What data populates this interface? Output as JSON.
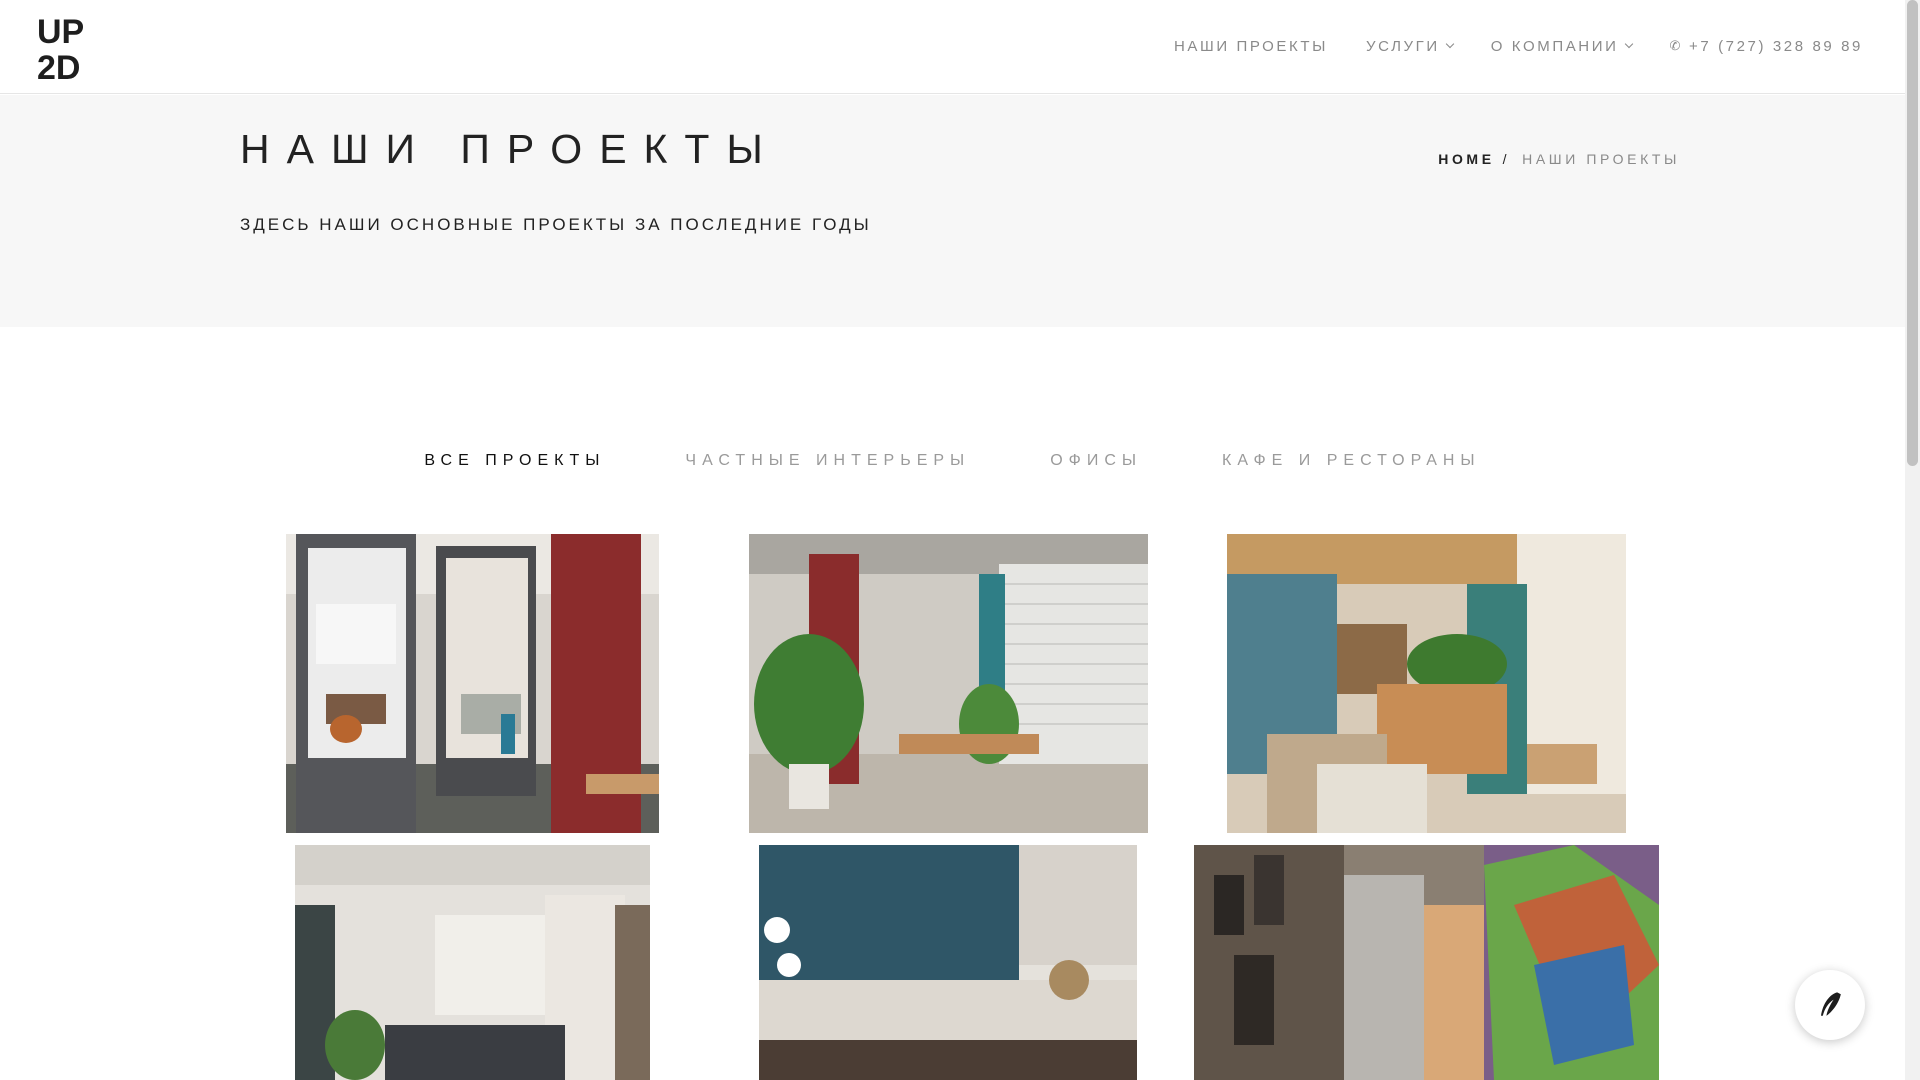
{
  "header": {
    "logo_top": "UP",
    "logo_bottom": "2D",
    "nav": [
      {
        "label": "НАШИ ПРОЕКТЫ"
      },
      {
        "label": "УСЛУГИ"
      },
      {
        "label": "О КОМПАНИИ"
      }
    ],
    "phone": "+7 (727) 328 89 89"
  },
  "title_band": {
    "title": "НАШИ ПРОЕКТЫ",
    "subtitle": "ЗДЕСЬ НАШИ ОСНОВНЫЕ ПРОЕКТЫ ЗА ПОСЛЕДНИЕ ГОДЫ",
    "breadcrumb_home": "HOME",
    "breadcrumb_sep": "/",
    "breadcrumb_current": "НАШИ ПРОЕКТЫ"
  },
  "filters": [
    {
      "label": "ВСЕ ПРОЕКТЫ",
      "active": true
    },
    {
      "label": "ЧАСТНЫЕ ИНТЕРЬЕРЫ",
      "active": false
    },
    {
      "label": "ОФИСЫ",
      "active": false
    },
    {
      "label": "КАФЕ И РЕСТОРАНЫ",
      "active": false
    }
  ],
  "projects": [
    {
      "subject": "office-meeting-room"
    },
    {
      "subject": "cafe-with-plants"
    },
    {
      "subject": "restaurant-bar"
    },
    {
      "subject": "living-room"
    },
    {
      "subject": "kitchen"
    },
    {
      "subject": "corridor-with-mural"
    }
  ],
  "colors": {
    "accent_text": "#111111",
    "muted_text": "#8a8a8a",
    "band_bg": "#f7f7f7"
  }
}
